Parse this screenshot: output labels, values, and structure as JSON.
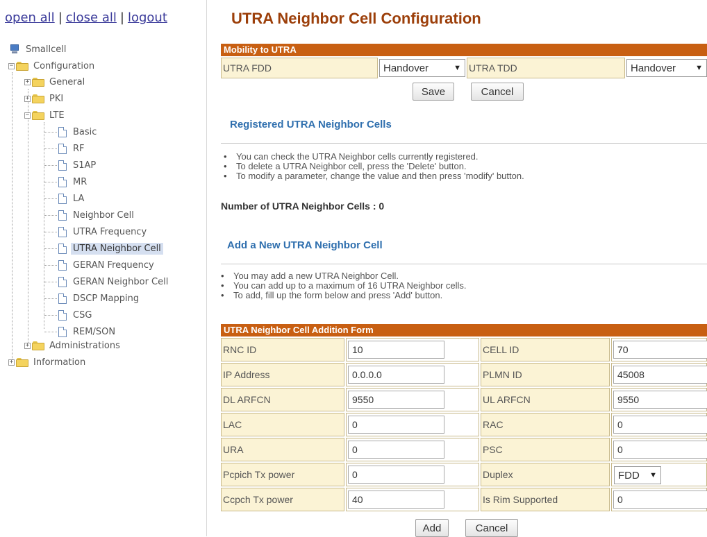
{
  "nav": {
    "open_all": "open all",
    "close_all": "close all",
    "logout": "logout",
    "separator": "|"
  },
  "tree": {
    "root": "Smallcell",
    "configuration": "Configuration",
    "general": "General",
    "pki": "PKI",
    "lte": "LTE",
    "lte_items": [
      "Basic",
      "RF",
      "S1AP",
      "MR",
      "LA",
      "Neighbor Cell",
      "UTRA Frequency",
      "UTRA Neighbor Cell",
      "GERAN Frequency",
      "GERAN Neighbor Cell",
      "DSCP Mapping",
      "CSG",
      "REM/SON"
    ],
    "selected": "UTRA Neighbor Cell",
    "administrations": "Administrations",
    "information": "Information"
  },
  "page": {
    "title": "UTRA Neighbor Cell Configuration"
  },
  "mobility": {
    "header": "Mobility to UTRA",
    "fdd_label": "UTRA FDD",
    "fdd_value": "Handover",
    "tdd_label": "UTRA TDD",
    "tdd_value": "Handover",
    "save": "Save",
    "cancel": "Cancel"
  },
  "registered": {
    "heading": "Registered UTRA Neighbor Cells",
    "bullets": [
      "You can check the UTRA Neighbor cells currently registered.",
      "To delete a UTRA Neighbor cell, press the 'Delete' button.",
      "To modify a parameter, change the value and then press 'modify' button."
    ],
    "count_text": "Number of UTRA Neighbor Cells : 0"
  },
  "add": {
    "heading": "Add a New UTRA Neighbor Cell",
    "bullets": [
      "You may add a new UTRA Neighbor Cell.",
      "You can add up to a maximum of 16 UTRA Neighbor cells.",
      "To add, fill up the form below and press 'Add' button."
    ]
  },
  "form": {
    "header": "UTRA Neighbor Cell Addition Form",
    "rows": [
      {
        "l1": "RNC ID",
        "v1": "10",
        "l2": "CELL ID",
        "v2": "70"
      },
      {
        "l1": "IP Address",
        "v1": "0.0.0.0",
        "l2": "PLMN ID",
        "v2": "45008"
      },
      {
        "l1": "DL ARFCN",
        "v1": "9550",
        "l2": "UL ARFCN",
        "v2": "9550"
      },
      {
        "l1": "LAC",
        "v1": "0",
        "l2": "RAC",
        "v2": "0"
      },
      {
        "l1": "URA",
        "v1": "0",
        "l2": "PSC",
        "v2": "0"
      },
      {
        "l1": "Pcpich Tx power",
        "v1": "0",
        "l2": "Duplex",
        "v2": "FDD"
      },
      {
        "l1": "Ccpch Tx power",
        "v1": "40",
        "l2": "Is Rim Supported",
        "v2": "0"
      }
    ],
    "add": "Add",
    "cancel": "Cancel"
  },
  "colors": {
    "title": "#9c3f0a",
    "bar": "#c85f12",
    "subheading": "#2f6fae",
    "link": "#3a3a9a",
    "label_cell": "#fbf3d5",
    "selected_tree_item": "#d5dff0"
  }
}
